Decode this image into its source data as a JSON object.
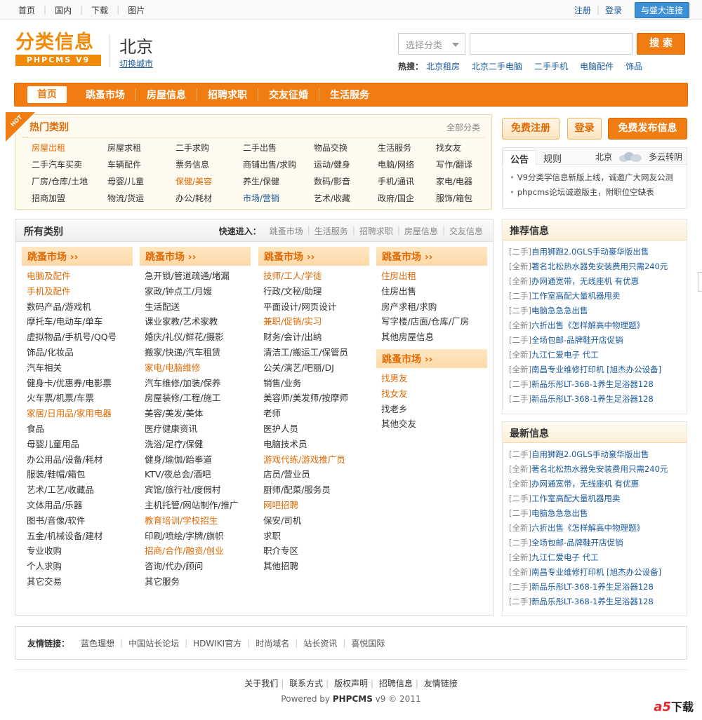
{
  "topbar": {
    "left": [
      "首页",
      "国内",
      "下载",
      "图片"
    ],
    "register": "注册",
    "login": "登录",
    "connect": "与盛大连接"
  },
  "header": {
    "logo_cn": "分类信息",
    "logo_en": "PHPCMS V9",
    "city": "北京",
    "switch_city": "切换城市",
    "select_placeholder": "选择分类",
    "search_btn": "搜 索",
    "hot_label": "热搜：",
    "hot_keywords": [
      "北京租房",
      "北京二手电脑",
      "二手手机",
      "电脑配件",
      "饰品"
    ]
  },
  "nav": [
    "首页",
    "跳蚤市场",
    "房屋信息",
    "招聘求职",
    "交友征婚",
    "生活服务"
  ],
  "hot": {
    "ribbon": "HOT",
    "title": "热门类别",
    "all": "全部分类",
    "rows": [
      [
        "房屋出租",
        "房屋求租",
        "二手求购",
        "二手出售",
        "物品交换",
        "生活服务",
        "找女友"
      ],
      [
        "二手汽车买卖",
        "车辆配件",
        "票务信息",
        "商铺出售/求购",
        "运动/健身",
        "电脑/网络",
        "写作/翻译"
      ],
      [
        "厂房/仓库/土地",
        "母婴/儿童",
        "保健/美容",
        "养生/保健",
        "数码/影音",
        "手机/通讯",
        "家电/电器"
      ],
      [
        "招商加盟",
        "物流/货运",
        "办公/耗材",
        "市场/营销",
        "艺术/收藏",
        "政府/国企",
        "服饰/箱包"
      ]
    ]
  },
  "all": {
    "title": "所有类别",
    "quick_label": "快速进入：",
    "quick": [
      "跳蚤市场",
      "生活服务",
      "招聘求职",
      "房屋信息",
      "交友信息"
    ],
    "columns": [
      {
        "groups": [
          {
            "head": "跳蚤市场 ››",
            "items": [
              "电脑及配件",
              "手机及配件",
              "数码产品/游戏机",
              "摩托车/电动车/单车",
              "虚拟物品/手机号/QQ号",
              "饰品/化妆品",
              "汽车相关",
              "健身卡/优惠券/电影票",
              "火车票/机票/车票",
              "家居/日用品/家用电器",
              "食品",
              "母婴儿童用品",
              "办公用品/设备/耗材",
              "服装/鞋帽/箱包",
              "艺术/工艺/收藏品",
              "文体用品/乐器",
              "图书/音像/软件",
              "五金/机械设备/建材",
              "专业收购",
              "个人求购",
              "其它交易"
            ],
            "hl": [
              0,
              1,
              9
            ]
          }
        ]
      },
      {
        "groups": [
          {
            "head": "跳蚤市场 ››",
            "items": [
              "急开锁/管道疏通/堵漏",
              "家政/钟点工/月嫂",
              "生活配送",
              "课业家教/艺术家教",
              "婚庆/礼仪/鲜花/摄影",
              "搬家/快递/汽车租赁",
              "家电/电脑维修",
              "汽车维修/加装/保养",
              "房屋装修/工程/施工",
              "美容/美发/美体",
              "医疗健康资讯",
              "洗浴/足疗/保健",
              "健身/瑜伽/跆拳道",
              "KTV/夜总会/酒吧",
              "宾馆/旅行社/度假村",
              "主机托管/网站制作/推广",
              "教育培训/学校招生",
              "印刷/喷绘/字牌/旗帜",
              "招商/合作/融资/创业",
              "咨询/代办/顾问",
              "其它服务"
            ],
            "hl": [
              6,
              16,
              18
            ]
          }
        ]
      },
      {
        "groups": [
          {
            "head": "跳蚤市场 ››",
            "items": [
              "技师/工人/学徒",
              "行政/文秘/助理",
              "平面设计/网页设计",
              "兼职/促销/实习",
              "财务/会计/出纳",
              "清洁工/搬运工/保管员",
              "公关/演艺/吧丽/DJ",
              "销售/业务",
              "美容师/美发师/按摩师",
              "老师",
              "医护人员",
              "电脑技术员",
              "游戏代练/游戏推广员",
              "店员/营业员",
              "厨师/配菜/服务员",
              "网吧招聘",
              "保安/司机",
              "求职",
              "职介专区",
              "其他招聘"
            ],
            "hl": [
              0,
              3,
              12,
              15
            ]
          }
        ]
      },
      {
        "groups": [
          {
            "head": "跳蚤市场 ››",
            "items": [
              "住房出租",
              "住房出售",
              "房产求租/求购",
              "写字楼/店面/仓库/厂房",
              "其他房屋信息"
            ],
            "hl": [
              0
            ]
          },
          {
            "head": "跳蚤市场 ››",
            "items": [
              "找男友",
              "找女友",
              "找老乡",
              "其他交友"
            ],
            "hl": [
              0,
              1
            ]
          }
        ]
      }
    ]
  },
  "right": {
    "btn_register": "免费注册",
    "btn_login": "登录",
    "btn_publish": "免费发布信息",
    "tab_notice": "公告",
    "tab_rules": "规则",
    "weather_city": "北京",
    "weather_text": "多云转阴",
    "notices": [
      "V9分类学信息新版上线，诚邀广大网友公测",
      "phpcms论坛诚邀版主，附职位空缺表"
    ],
    "recommend_title": "推荐信息",
    "latest_title": "最新信息",
    "info_items": [
      {
        "tag": "[二手]",
        "text": "自用狮跑2.0GLS手动豪华版出售"
      },
      {
        "tag": "[全新]",
        "text": "著名北松热水器免安装费用只需240元"
      },
      {
        "tag": "[全新]",
        "text": "办网通宽带，无线座机 有优惠"
      },
      {
        "tag": "[二手]",
        "text": "工作室高配大量机器甩卖"
      },
      {
        "tag": "[二手]",
        "text": "电脑急急急出售"
      },
      {
        "tag": "[全新]",
        "text": "六折出售《怎样解高中物理题》"
      },
      {
        "tag": "[二手]",
        "text": "全场包邮-品牌鞋开店促销"
      },
      {
        "tag": "[全新]",
        "text": "九江仁爱电子 代工"
      },
      {
        "tag": "[全新]",
        "text": "南昌专业维修打印机 [旭杰办公设备]"
      },
      {
        "tag": "[二手]",
        "text": "新品乐彤LT-368-1养生足浴器128"
      },
      {
        "tag": "[二手]",
        "text": "新品乐彤LT-368-1养生足浴器128"
      }
    ]
  },
  "friend_links": {
    "label": "友情链接：",
    "items": [
      "蓝色理想",
      "中国站长论坛",
      "HDWIKI官方",
      "时尚域名",
      "站长资讯",
      "喜悦国际"
    ]
  },
  "footer": {
    "links": [
      "关于我们",
      "联系方式",
      "版权声明",
      "招聘信息",
      "友情链接"
    ],
    "powered_prefix": "Powered by",
    "powered_brand": "PHPCMS",
    "powered_suffix": "v9 © 2011",
    "watermark_a5": "a5",
    "watermark_dl": "下载"
  },
  "colors": {
    "brand_orange": "#f07c12",
    "link_blue": "#1a5a9c",
    "highlight_orange": "#e06a05"
  }
}
